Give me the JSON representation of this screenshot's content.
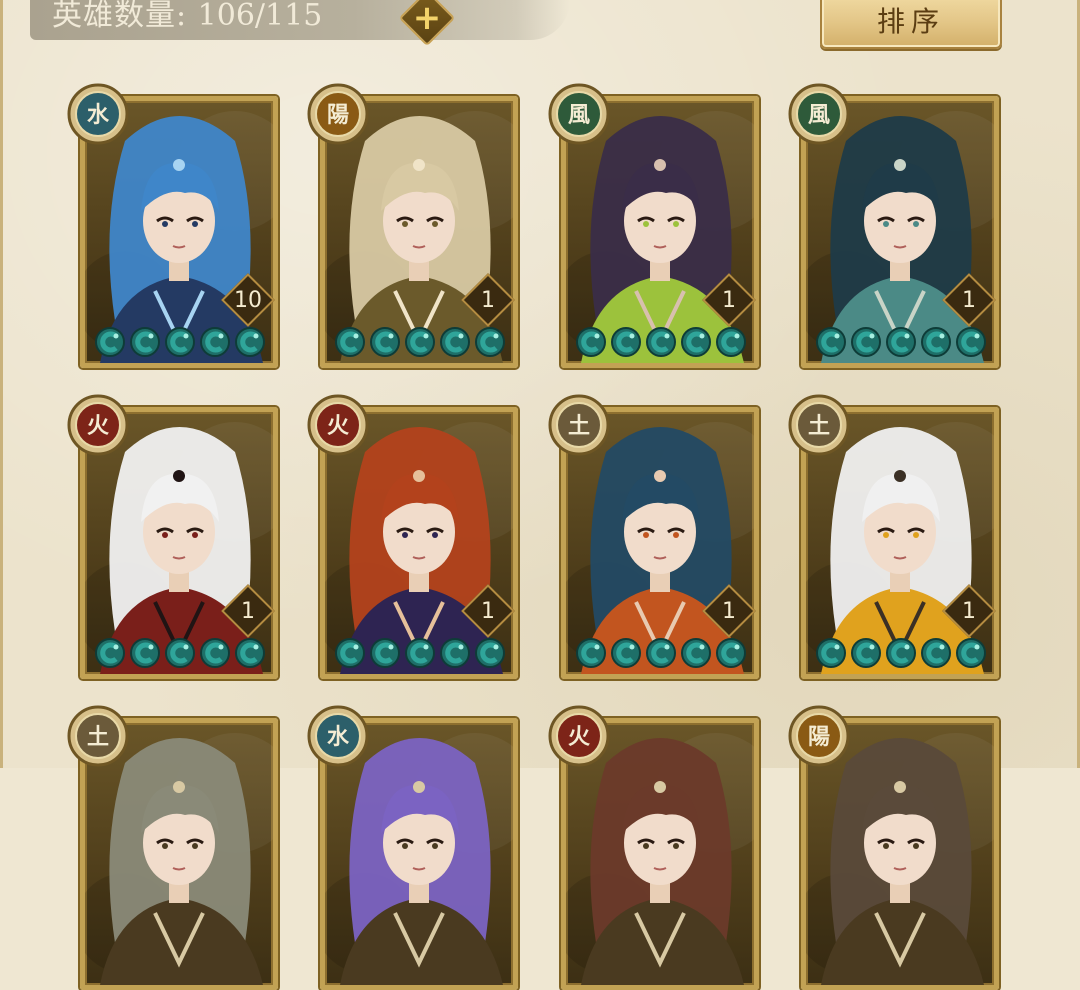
{
  "header": {
    "hero_count_label": "英雄数量:",
    "hero_count_value": "106/115",
    "add_button_icon": "plus-icon",
    "sort_button_label": "排序"
  },
  "colors": {
    "water": "#2c5f6a",
    "yang": "#8a5a14",
    "wind": "#2e5a3a",
    "fire": "#7d2418",
    "earth": "#6b5a3a",
    "jade": "#2fa59a"
  },
  "heroes": [
    {
      "element": "水",
      "element_type": "water",
      "level": "10",
      "stars": 5,
      "palette": [
        "#3f86c9",
        "#243a63",
        "#a7d4f2"
      ]
    },
    {
      "element": "陽",
      "element_type": "yang",
      "level": "1",
      "stars": 5,
      "palette": [
        "#d8c9a3",
        "#6b5a2b",
        "#f0e4c8"
      ]
    },
    {
      "element": "風",
      "element_type": "wind",
      "level": "1",
      "stars": 5,
      "palette": [
        "#3a2d48",
        "#9cc23c",
        "#d8c0ae"
      ]
    },
    {
      "element": "風",
      "element_type": "wind",
      "level": "1",
      "stars": 5,
      "palette": [
        "#1f3b48",
        "#4b8a86",
        "#c9d4c7"
      ]
    },
    {
      "element": "火",
      "element_type": "fire",
      "level": "1",
      "stars": 5,
      "palette": [
        "#f1f1f1",
        "#7a1f1a",
        "#201414"
      ]
    },
    {
      "element": "火",
      "element_type": "fire",
      "level": "1",
      "stars": 5,
      "palette": [
        "#b3421c",
        "#2e2452",
        "#e6c09a"
      ]
    },
    {
      "element": "土",
      "element_type": "earth",
      "level": "1",
      "stars": 5,
      "palette": [
        "#234a64",
        "#c2551f",
        "#e8cab0"
      ]
    },
    {
      "element": "土",
      "element_type": "earth",
      "level": "1",
      "stars": 5,
      "palette": [
        "#f0f0f0",
        "#e0a21e",
        "#3b3025"
      ]
    },
    {
      "element": "土",
      "element_type": "earth",
      "level": "",
      "stars": 0,
      "palette": [
        "#8a8a78",
        "#4a3a20",
        "#d8c9a3"
      ]
    },
    {
      "element": "水",
      "element_type": "water",
      "level": "",
      "stars": 0,
      "palette": [
        "#7b63c2",
        "#4a3a20",
        "#d8c9a3"
      ]
    },
    {
      "element": "火",
      "element_type": "fire",
      "level": "",
      "stars": 0,
      "palette": [
        "#6b3a2a",
        "#4a3a20",
        "#d8c9a3"
      ]
    },
    {
      "element": "陽",
      "element_type": "yang",
      "level": "",
      "stars": 0,
      "palette": [
        "#5a4a3a",
        "#4a3a20",
        "#d8c9a3"
      ]
    }
  ]
}
